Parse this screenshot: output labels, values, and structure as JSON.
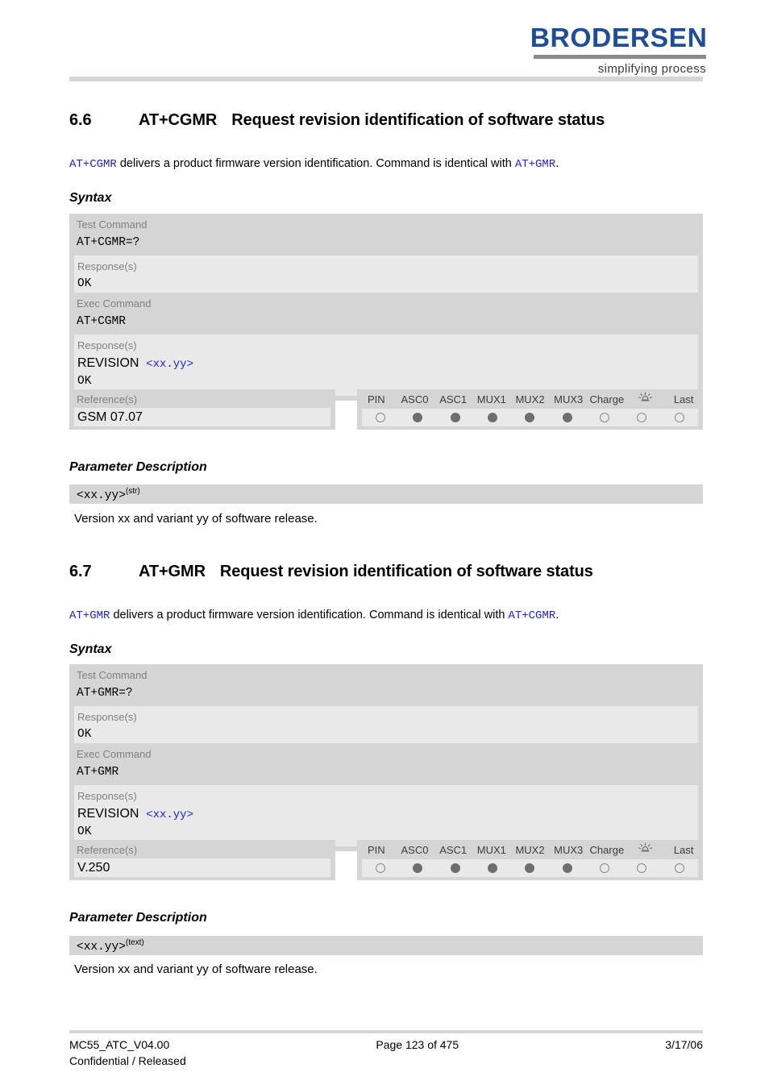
{
  "brand": {
    "name": "BRODERSEN",
    "tagline": "simplifying process",
    "color": "#1f4e99"
  },
  "sections": [
    {
      "number": "6.6",
      "command": "AT+CGMR",
      "title": "Request revision identification of software status",
      "intro": {
        "code_lead": "AT+CGMR",
        "text_mid": " delivers a product firmware version identification. Command is identical with ",
        "code_tail": "AT+GMR",
        "text_end": "."
      },
      "syntax_heading": "Syntax",
      "test": {
        "label": "Test Command",
        "command": "AT+CGMR=?",
        "response_label": "Response(s)",
        "response_lines": [
          "OK"
        ]
      },
      "exec": {
        "label": "Exec Command",
        "command": "AT+CGMR",
        "response_label": "Response(s)",
        "response_revision_word": "REVISION",
        "response_revision_param": "<xx.yy>",
        "response_ok": "OK"
      },
      "reference": {
        "label": "Reference(s)",
        "value": "GSM 07.07"
      },
      "capabilities": {
        "headers": [
          "PIN",
          "ASC0",
          "ASC1",
          "MUX1",
          "MUX2",
          "MUX3",
          "Charge",
          "alarm-icon",
          "Last"
        ],
        "states": [
          "empty",
          "filled",
          "filled",
          "filled",
          "filled",
          "filled",
          "empty",
          "empty",
          "empty"
        ]
      },
      "param_heading": "Parameter Description",
      "param": {
        "name": "<xx.yy>",
        "type": "(str)",
        "description": "Version xx and variant yy of software release."
      }
    },
    {
      "number": "6.7",
      "command": "AT+GMR",
      "title": "Request revision identification of software status",
      "intro": {
        "code_lead": "AT+GMR",
        "text_mid": " delivers a product firmware version identification. Command is identical with ",
        "code_tail": "AT+CGMR",
        "text_end": "."
      },
      "syntax_heading": "Syntax",
      "test": {
        "label": "Test Command",
        "command": "AT+GMR=?",
        "response_label": "Response(s)",
        "response_lines": [
          "OK"
        ]
      },
      "exec": {
        "label": "Exec Command",
        "command": "AT+GMR",
        "response_label": "Response(s)",
        "response_revision_word": "REVISION",
        "response_revision_param": "<xx.yy>",
        "response_ok": "OK"
      },
      "reference": {
        "label": "Reference(s)",
        "value": "V.250"
      },
      "capabilities": {
        "headers": [
          "PIN",
          "ASC0",
          "ASC1",
          "MUX1",
          "MUX2",
          "MUX3",
          "Charge",
          "alarm-icon",
          "Last"
        ],
        "states": [
          "empty",
          "filled",
          "filled",
          "filled",
          "filled",
          "filled",
          "empty",
          "empty",
          "empty"
        ]
      },
      "param_heading": "Parameter Description",
      "param": {
        "name": "<xx.yy>",
        "type": "(text)",
        "description": "Version xx and variant yy of software release."
      }
    }
  ],
  "footer": {
    "doc_id": "MC55_ATC_V04.00",
    "classification": "Confidential / Released",
    "page": "Page 123 of 475",
    "date": "3/17/06"
  }
}
